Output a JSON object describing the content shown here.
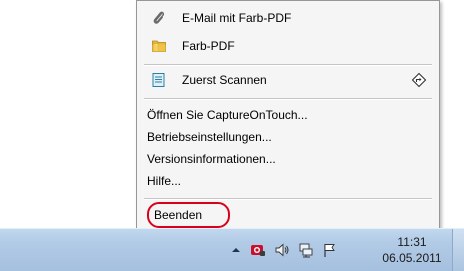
{
  "menu": {
    "items": [
      {
        "label": "E-Mail mit Farb-PDF",
        "icon": "paperclip-icon"
      },
      {
        "label": "Farb-PDF",
        "icon": "folder-icon"
      },
      {
        "label": "Zuerst Scannen",
        "icon": "document-icon",
        "shortcut_icon": "diamond-arrow-icon"
      },
      {
        "label": "Öffnen Sie CaptureOnTouch..."
      },
      {
        "label": "Betriebseinstellungen..."
      },
      {
        "label": "Versionsinformationen..."
      },
      {
        "label": "Hilfe..."
      },
      {
        "label": "Beenden",
        "highlighted": true
      }
    ]
  },
  "taskbar": {
    "tray_icons": [
      "chevron-up-icon",
      "capture-on-touch-icon",
      "speaker-icon",
      "network-icon",
      "flag-icon"
    ],
    "clock": {
      "time": "11:31",
      "date": "06.05.2011"
    }
  },
  "colors": {
    "menu_background": "#f5f5f5",
    "highlight_ring": "#d9001b",
    "taskbar": "#b2cbe6"
  }
}
